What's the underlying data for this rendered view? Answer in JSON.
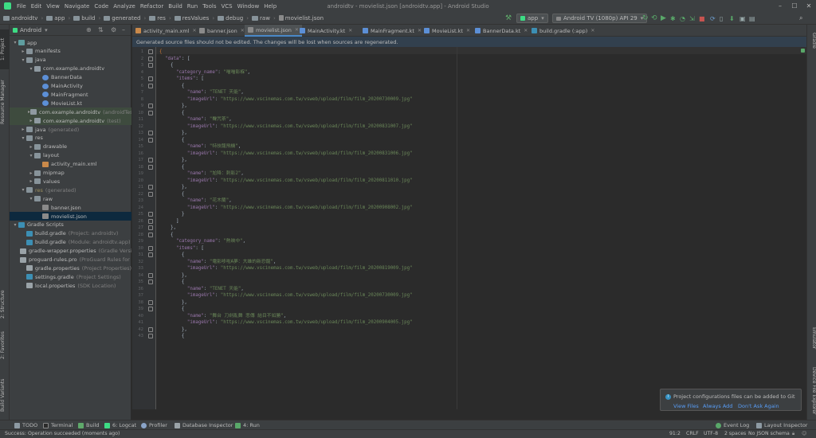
{
  "menubar": {
    "items": [
      "File",
      "Edit",
      "View",
      "Navigate",
      "Code",
      "Analyze",
      "Refactor",
      "Build",
      "Run",
      "Tools",
      "VCS",
      "Window",
      "Help"
    ],
    "window_title": "androidtv - movielist.json [androidtv.app] - Android Studio"
  },
  "navbar": {
    "crumbs": [
      "androidtv",
      "app",
      "build",
      "generated",
      "res",
      "resValues",
      "debug",
      "raw",
      "movielist.json"
    ],
    "run_config": "app",
    "device": "Android TV (1080p) API 29"
  },
  "left_stripe": {
    "project": "1: Project",
    "resource_manager": "Resource Manager",
    "structure": "2: Structure",
    "favorites": "2: Favorites",
    "build_variants": "Build Variants"
  },
  "right_stripe": {
    "gradle": "Gradle",
    "emulator": "Emulator",
    "device_file_explorer": "Device File Explorer"
  },
  "project_panel": {
    "view_mode": "Android",
    "tree": [
      {
        "label": "app",
        "hint": "",
        "depth": 0,
        "arrow": "▾",
        "icon": "module",
        "state": ""
      },
      {
        "label": "manifests",
        "hint": "",
        "depth": 1,
        "arrow": "▸",
        "icon": "folder",
        "state": ""
      },
      {
        "label": "java",
        "hint": "",
        "depth": 1,
        "arrow": "▾",
        "icon": "folder",
        "state": ""
      },
      {
        "label": "com.example.androidtv",
        "hint": "",
        "depth": 2,
        "arrow": "▾",
        "icon": "package",
        "state": ""
      },
      {
        "label": "BannerData",
        "hint": "",
        "depth": 3,
        "arrow": "",
        "icon": "kotlin",
        "state": ""
      },
      {
        "label": "MainActivity",
        "hint": "",
        "depth": 3,
        "arrow": "",
        "icon": "kotlin",
        "state": ""
      },
      {
        "label": "MainFragment",
        "hint": "",
        "depth": 3,
        "arrow": "",
        "icon": "kotlin",
        "state": ""
      },
      {
        "label": "MovieList.kt",
        "hint": "",
        "depth": 3,
        "arrow": "",
        "icon": "kotlin",
        "state": ""
      },
      {
        "label": "com.example.androidtv",
        "hint": "(androidTest)",
        "depth": 2,
        "arrow": "▸",
        "icon": "package",
        "state": "hl"
      },
      {
        "label": "com.example.androidtv",
        "hint": "(test)",
        "depth": 2,
        "arrow": "▸",
        "icon": "package",
        "state": "hl"
      },
      {
        "label": "java",
        "hint": "(generated)",
        "depth": 1,
        "arrow": "▸",
        "icon": "folder",
        "state": ""
      },
      {
        "label": "res",
        "hint": "",
        "depth": 1,
        "arrow": "▾",
        "icon": "folder",
        "state": ""
      },
      {
        "label": "drawable",
        "hint": "",
        "depth": 2,
        "arrow": "▸",
        "icon": "folder",
        "state": ""
      },
      {
        "label": "layout",
        "hint": "",
        "depth": 2,
        "arrow": "▾",
        "icon": "folder",
        "state": ""
      },
      {
        "label": "activity_main.xml",
        "hint": "",
        "depth": 3,
        "arrow": "",
        "icon": "xml",
        "state": ""
      },
      {
        "label": "mipmap",
        "hint": "",
        "depth": 2,
        "arrow": "▸",
        "icon": "folder",
        "state": ""
      },
      {
        "label": "values",
        "hint": "",
        "depth": 2,
        "arrow": "▸",
        "icon": "folder",
        "state": ""
      },
      {
        "label": "res",
        "hint": "(generated)",
        "depth": 1,
        "arrow": "▾",
        "icon": "folder",
        "state": "gen"
      },
      {
        "label": "raw",
        "hint": "",
        "depth": 2,
        "arrow": "▾",
        "icon": "folder",
        "state": ""
      },
      {
        "label": "banner.json",
        "hint": "",
        "depth": 3,
        "arrow": "",
        "icon": "json",
        "state": ""
      },
      {
        "label": "movielist.json",
        "hint": "",
        "depth": 3,
        "arrow": "",
        "icon": "json",
        "state": "sel"
      },
      {
        "label": "Gradle Scripts",
        "hint": "",
        "depth": 0,
        "arrow": "▾",
        "icon": "gradle",
        "state": ""
      },
      {
        "label": "build.gradle",
        "hint": "(Project: androidtv)",
        "depth": 1,
        "arrow": "",
        "icon": "gradle",
        "state": ""
      },
      {
        "label": "build.gradle",
        "hint": "(Module: androidtv.app)",
        "depth": 1,
        "arrow": "",
        "icon": "gradle",
        "state": ""
      },
      {
        "label": "gradle-wrapper.properties",
        "hint": "(Gradle Version)",
        "depth": 1,
        "arrow": "",
        "icon": "props",
        "state": ""
      },
      {
        "label": "proguard-rules.pro",
        "hint": "(ProGuard Rules for androidtv.app)",
        "depth": 1,
        "arrow": "",
        "icon": "props",
        "state": ""
      },
      {
        "label": "gradle.properties",
        "hint": "(Project Properties)",
        "depth": 1,
        "arrow": "",
        "icon": "props",
        "state": ""
      },
      {
        "label": "settings.gradle",
        "hint": "(Project Settings)",
        "depth": 1,
        "arrow": "",
        "icon": "gradle",
        "state": ""
      },
      {
        "label": "local.properties",
        "hint": "(SDK Location)",
        "depth": 1,
        "arrow": "",
        "icon": "props",
        "state": ""
      }
    ]
  },
  "tabs": [
    {
      "label": "activity_main.xml",
      "icon": "xml",
      "active": false
    },
    {
      "label": "banner.json",
      "icon": "json",
      "active": false
    },
    {
      "label": "movielist.json",
      "icon": "json",
      "active": true
    },
    {
      "label": "MainActivity.kt",
      "icon": "kotlin",
      "active": false
    },
    {
      "label": "MainFragment.kt",
      "icon": "kotlin",
      "active": false
    },
    {
      "label": "MovieList.kt",
      "icon": "kotlin",
      "active": false
    },
    {
      "label": "BannerData.kt",
      "icon": "kotlin",
      "active": false
    },
    {
      "label": "build.gradle (:app)",
      "icon": "gradle",
      "active": false
    }
  ],
  "banner": {
    "text": "Generated source files should not be edited. The changes will be lost when sources are regenerated."
  },
  "editor": {
    "lines": [
      [
        [
          "p",
          "{"
        ]
      ],
      [
        [
          "t",
          "  "
        ],
        [
          "k",
          "\"data\""
        ],
        [
          "t",
          ": ["
        ]
      ],
      [
        [
          "t",
          "    {"
        ]
      ],
      [
        [
          "t",
          "      "
        ],
        [
          "k",
          "\"category_name\""
        ],
        [
          "t",
          ": "
        ],
        [
          "s",
          "\"喵喵影褓\""
        ],
        [
          "t",
          ","
        ]
      ],
      [
        [
          "t",
          "      "
        ],
        [
          "k",
          "\"items\""
        ],
        [
          "t",
          ": ["
        ]
      ],
      [
        [
          "t",
          "        {"
        ]
      ],
      [
        [
          "t",
          "          "
        ],
        [
          "k",
          "\"name\""
        ],
        [
          "t",
          ": "
        ],
        [
          "s",
          "\"TENET 天能\""
        ],
        [
          "t",
          ","
        ]
      ],
      [
        [
          "t",
          "          "
        ],
        [
          "k",
          "\"imageUrl\""
        ],
        [
          "t",
          ": "
        ],
        [
          "s",
          "\"https://www.vscinemas.com.tw/vsweb/upload/film/film_20200730009.jpg\""
        ]
      ],
      [
        [
          "t",
          "        },"
        ]
      ],
      [
        [
          "t",
          "        {"
        ]
      ],
      [
        [
          "t",
          "          "
        ],
        [
          "k",
          "\"name\""
        ],
        [
          "t",
          ": "
        ],
        [
          "s",
          "\"聲咒茶\""
        ],
        [
          "t",
          ","
        ]
      ],
      [
        [
          "t",
          "          "
        ],
        [
          "k",
          "\"imageUrl\""
        ],
        [
          "t",
          ": "
        ],
        [
          "s",
          "\"https://www.vscinemas.com.tw/vsweb/upload/film/film_20200831007.jpg\""
        ]
      ],
      [
        [
          "t",
          "        },"
        ]
      ],
      [
        [
          "t",
          "        {"
        ]
      ],
      [
        [
          "t",
          "          "
        ],
        [
          "k",
          "\"name\""
        ],
        [
          "t",
          ": "
        ],
        [
          "s",
          "\"特技龍飛機\""
        ],
        [
          "t",
          ","
        ]
      ],
      [
        [
          "t",
          "          "
        ],
        [
          "k",
          "\"imageUrl\""
        ],
        [
          "t",
          ": "
        ],
        [
          "s",
          "\"https://www.vscinemas.com.tw/vsweb/upload/film/film_20200831006.jpg\""
        ]
      ],
      [
        [
          "t",
          "        },"
        ]
      ],
      [
        [
          "t",
          "        {"
        ]
      ],
      [
        [
          "t",
          "          "
        ],
        [
          "k",
          "\"name\""
        ],
        [
          "t",
          ": "
        ],
        [
          "s",
          "\"尬降：刺影2\""
        ],
        [
          "t",
          ","
        ]
      ],
      [
        [
          "t",
          "          "
        ],
        [
          "k",
          "\"imageUrl\""
        ],
        [
          "t",
          ": "
        ],
        [
          "s",
          "\"https://www.vscinemas.com.tw/vsweb/upload/film/film_20200811010.jpg\""
        ]
      ],
      [
        [
          "t",
          "        },"
        ]
      ],
      [
        [
          "t",
          "        {"
        ]
      ],
      [
        [
          "t",
          "          "
        ],
        [
          "k",
          "\"name\""
        ],
        [
          "t",
          ": "
        ],
        [
          "s",
          "\"花木蘭\""
        ],
        [
          "t",
          ","
        ]
      ],
      [
        [
          "t",
          "          "
        ],
        [
          "k",
          "\"imageUrl\""
        ],
        [
          "t",
          ": "
        ],
        [
          "s",
          "\"https://www.vscinemas.com.tw/vsweb/upload/film/film_20200908002.jpg\""
        ]
      ],
      [
        [
          "t",
          "        }"
        ]
      ],
      [
        [
          "t",
          "      ]"
        ]
      ],
      [
        [
          "t",
          "    },"
        ]
      ],
      [
        [
          "t",
          "    {"
        ]
      ],
      [
        [
          "t",
          "      "
        ],
        [
          "k",
          "\"category_name\""
        ],
        [
          "t",
          ": "
        ],
        [
          "s",
          "\"熱映中\""
        ],
        [
          "t",
          ","
        ]
      ],
      [
        [
          "t",
          "      "
        ],
        [
          "k",
          "\"items\""
        ],
        [
          "t",
          ": ["
        ]
      ],
      [
        [
          "t",
          "        {"
        ]
      ],
      [
        [
          "t",
          "          "
        ],
        [
          "k",
          "\"name\""
        ],
        [
          "t",
          ": "
        ],
        [
          "s",
          "\"電影哆啦A夢：大雄的新恐龍\""
        ],
        [
          "t",
          ","
        ]
      ],
      [
        [
          "t",
          "          "
        ],
        [
          "k",
          "\"imageUrl\""
        ],
        [
          "t",
          ": "
        ],
        [
          "s",
          "\"https://www.vscinemas.com.tw/vsweb/upload/film/film_20200819009.jpg\""
        ]
      ],
      [
        [
          "t",
          "        },"
        ]
      ],
      [
        [
          "t",
          "        {"
        ]
      ],
      [
        [
          "t",
          "          "
        ],
        [
          "k",
          "\"name\""
        ],
        [
          "t",
          ": "
        ],
        [
          "s",
          "\"TENET 天能\""
        ],
        [
          "t",
          ","
        ]
      ],
      [
        [
          "t",
          "          "
        ],
        [
          "k",
          "\"imageUrl\""
        ],
        [
          "t",
          ": "
        ],
        [
          "s",
          "\"https://www.vscinemas.com.tw/vsweb/upload/film/film_20200730009.jpg\""
        ]
      ],
      [
        [
          "t",
          "        },"
        ]
      ],
      [
        [
          "t",
          "        {"
        ]
      ],
      [
        [
          "t",
          "          "
        ],
        [
          "k",
          "\"name\""
        ],
        [
          "t",
          ": "
        ],
        [
          "s",
          "\"舞台 刀劍亂舞 悲傳 結目不如勝\""
        ],
        [
          "t",
          ","
        ]
      ],
      [
        [
          "t",
          "          "
        ],
        [
          "k",
          "\"imageUrl\""
        ],
        [
          "t",
          ": "
        ],
        [
          "s",
          "\"https://www.vscinemas.com.tw/vsweb/upload/film/film_20200904005.jpg\""
        ]
      ],
      [
        [
          "t",
          "        },"
        ]
      ],
      [
        [
          "t",
          "        {"
        ]
      ]
    ]
  },
  "notification": {
    "message": "Project configurations files can be added to Git",
    "actions": [
      "View Files",
      "Always Add",
      "Don't Ask Again"
    ]
  },
  "bottom_tools": [
    {
      "label": "TODO"
    },
    {
      "label": "Terminal"
    },
    {
      "label": "Build"
    },
    {
      "label": "6: Logcat"
    },
    {
      "label": "Profiler"
    },
    {
      "label": "Database Inspector"
    },
    {
      "label": "4: Run"
    },
    {
      "label": "Event Log"
    },
    {
      "label": "Layout Inspector"
    }
  ],
  "status": {
    "message": "Success: Operation succeeded (moments ago)",
    "position": "91:2",
    "line_sep": "CRLF",
    "encoding": "UTF-8",
    "indent": "2 spaces",
    "schema": "No JSON schema"
  },
  "colors": {
    "kotlin": "#5c8fd6",
    "xml": "#c9894a",
    "json": "#8a8a8a",
    "folder": "#87939a",
    "package": "#8f9aa1",
    "module": "#5f9ea0",
    "gradle": "#3c8fb4",
    "props": "#9aa3a8"
  }
}
